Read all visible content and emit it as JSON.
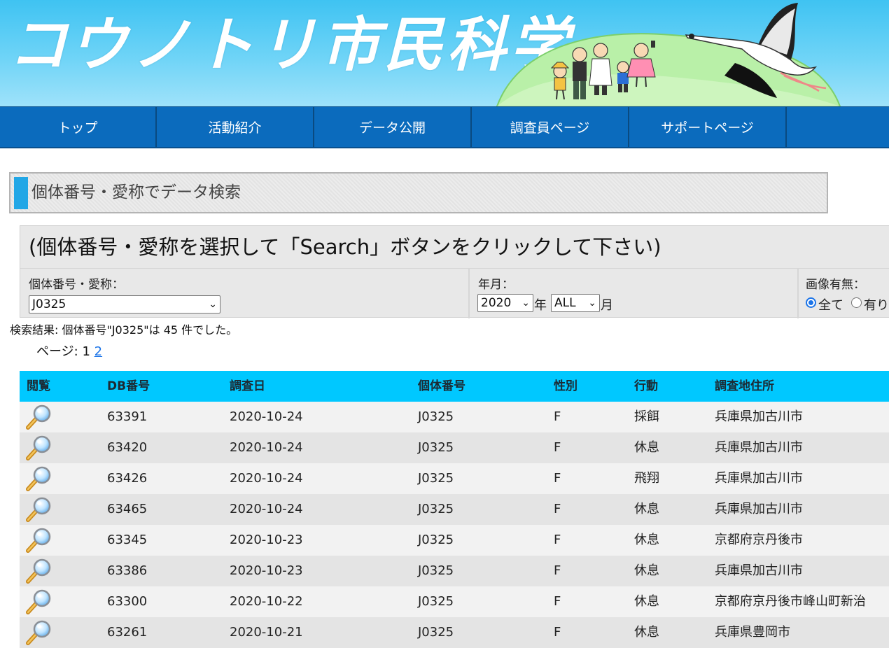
{
  "header": {
    "site_title": "コウノトリ市民科学"
  },
  "nav": {
    "items": [
      "トップ",
      "活動紹介",
      "データ公開",
      "調査員ページ",
      "サポートページ"
    ]
  },
  "section": {
    "title": "個体番号・愛称でデータ検索"
  },
  "search": {
    "instruction": "(個体番号・愛称を選択して「Search」ボタンをクリックして下さい)",
    "id_label": "個体番号・愛称：",
    "id_value": "J0325",
    "date_label": "年月：",
    "year_value": "2020",
    "year_unit": "年",
    "month_value": "ALL",
    "month_unit": "月",
    "image_label": "画像有無：",
    "image_options": [
      "全て",
      "有り"
    ],
    "image_selected": "全て"
  },
  "results": {
    "summary": "検索結果: 個体番号\"J0325\"は 45 件でした。",
    "pager_label": "ページ: ",
    "current_page": "1",
    "next_page": "2"
  },
  "table": {
    "columns": [
      "閲覧",
      "DB番号",
      "調査日",
      "個体番号",
      "性別",
      "行動",
      "調査地住所"
    ],
    "rows": [
      {
        "db": "63391",
        "date": "2020-10-24",
        "id": "J0325",
        "sex": "F",
        "behavior": "採餌",
        "address": "兵庫県加古川市"
      },
      {
        "db": "63420",
        "date": "2020-10-24",
        "id": "J0325",
        "sex": "F",
        "behavior": "休息",
        "address": "兵庫県加古川市"
      },
      {
        "db": "63426",
        "date": "2020-10-24",
        "id": "J0325",
        "sex": "F",
        "behavior": "飛翔",
        "address": "兵庫県加古川市"
      },
      {
        "db": "63465",
        "date": "2020-10-24",
        "id": "J0325",
        "sex": "F",
        "behavior": "休息",
        "address": "兵庫県加古川市"
      },
      {
        "db": "63345",
        "date": "2020-10-23",
        "id": "J0325",
        "sex": "F",
        "behavior": "休息",
        "address": "京都府京丹後市"
      },
      {
        "db": "63386",
        "date": "2020-10-23",
        "id": "J0325",
        "sex": "F",
        "behavior": "休息",
        "address": "兵庫県加古川市"
      },
      {
        "db": "63300",
        "date": "2020-10-22",
        "id": "J0325",
        "sex": "F",
        "behavior": "休息",
        "address": "京都府京丹後市峰山町新治"
      },
      {
        "db": "63261",
        "date": "2020-10-21",
        "id": "J0325",
        "sex": "F",
        "behavior": "休息",
        "address": "兵庫県豊岡市"
      }
    ],
    "view_icon": "magnifier-icon"
  },
  "colors": {
    "banner_sky": "#4cc8f4",
    "nav_bg": "#0b6bbd",
    "table_header": "#00c8ff",
    "accent_bar": "#22a7e6",
    "link": "#1a73e8"
  }
}
